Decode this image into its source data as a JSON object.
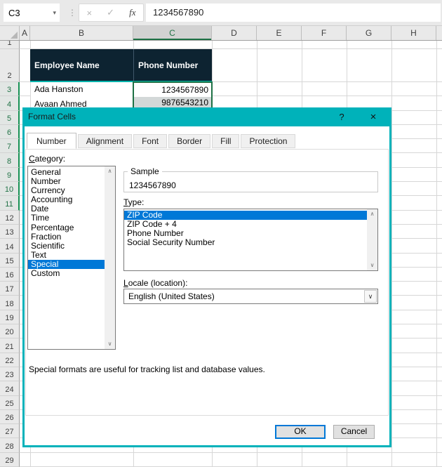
{
  "formula_bar": {
    "cell_reference": "C3",
    "formula_value": "1234567890",
    "dropdown_icon": "▾",
    "more_icon": "⋮",
    "cancel_icon": "×",
    "enter_icon": "✓",
    "function_icon": "fx"
  },
  "sheet": {
    "columns": [
      "A",
      "B",
      "C",
      "D",
      "E",
      "F",
      "G",
      "H"
    ],
    "selected_column": "C",
    "rows": [
      "1",
      "2",
      "3",
      "4",
      "5",
      "6",
      "7",
      "8",
      "9",
      "10",
      "11",
      "12",
      "13",
      "14",
      "15",
      "16",
      "17",
      "18",
      "19",
      "20",
      "21",
      "22",
      "23",
      "24",
      "25",
      "26",
      "27",
      "28",
      "29"
    ],
    "selected_rows": [
      "3",
      "4",
      "5",
      "6",
      "7",
      "8",
      "9",
      "10",
      "11"
    ],
    "table": {
      "header_name": "Employee Name",
      "header_phone": "Phone Number",
      "row1_name": "Ada Hanston",
      "row1_phone": "1234567890",
      "row2_name": "Avaan Ahmed",
      "row2_phone": "9876543210"
    }
  },
  "dialog": {
    "title": "Format Cells",
    "help_icon": "?",
    "close_icon": "×",
    "tabs": [
      "Number",
      "Alignment",
      "Font",
      "Border",
      "Fill",
      "Protection"
    ],
    "active_tab": "Number",
    "category_label": {
      "mnemonic": "C",
      "rest": "ategory:"
    },
    "categories": [
      "General",
      "Number",
      "Currency",
      "Accounting",
      "Date",
      "Time",
      "Percentage",
      "Fraction",
      "Scientific",
      "Text",
      "Special",
      "Custom"
    ],
    "selected_category": "Special",
    "sample_label": "Sample",
    "sample_value": "1234567890",
    "type_label": {
      "mnemonic": "T",
      "rest": "ype:"
    },
    "types": [
      "ZIP Code",
      "ZIP Code + 4",
      "Phone Number",
      "Social Security Number"
    ],
    "selected_type": "ZIP Code",
    "locale_label": {
      "mnemonic": "L",
      "rest": "ocale (location):"
    },
    "locale_value": "English (United States)",
    "description": "Special formats are useful for tracking list and database values.",
    "ok_label": "OK",
    "cancel_label": "Cancel",
    "scroll_up_icon": "∧",
    "scroll_down_icon": "∨",
    "combo_chevron_icon": "∨"
  },
  "colors": {
    "dialog_accent": "#00b2ba",
    "selection_blue": "#0078d7",
    "excel_green": "#217346",
    "table_header_bg": "#0d2331",
    "table_accent_teal": "#00b3ab"
  }
}
